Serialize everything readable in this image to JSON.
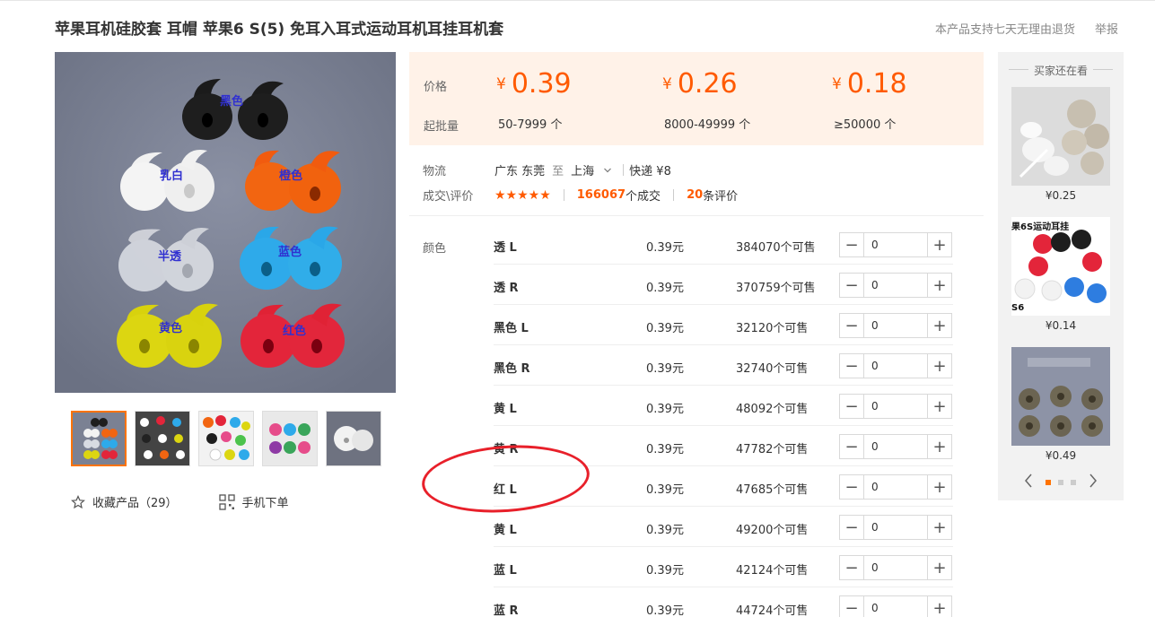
{
  "product": {
    "title": "苹果耳机硅胶套 耳帽 苹果6 S(5) 免耳入耳式运动耳机耳挂耳机套",
    "return_policy": "本产品支持七天无理由退货",
    "report": "举报"
  },
  "image_labels": {
    "black": "黑色",
    "milk_white": "乳白",
    "orange": "橙色",
    "translucent": "半透",
    "blue": "蓝色",
    "yellow": "黄色",
    "red": "红色"
  },
  "thumbnails": [
    "thumb-1",
    "thumb-2",
    "thumb-3",
    "thumb-4",
    "thumb-5"
  ],
  "actions": {
    "favorite": "收藏产品（29）",
    "mobile_order": "手机下单"
  },
  "pricing": {
    "price_label": "价格",
    "moq_label": "起批量",
    "currency": "¥",
    "tiers": [
      {
        "price": "0.39",
        "range": "50-7999 个"
      },
      {
        "price": "0.26",
        "range": "8000-49999 个"
      },
      {
        "price": "0.18",
        "range": "≥50000 个"
      }
    ]
  },
  "logistics": {
    "label": "物流",
    "from": "广东 东莞",
    "to_word": "至",
    "to": "上海",
    "express": "快递 ¥8"
  },
  "deals": {
    "label": "成交\\评价",
    "stars": "★★★★★",
    "count": "166067",
    "count_suffix": "个成交",
    "reviews": "20",
    "reviews_suffix": "条评价"
  },
  "sku": {
    "label": "颜色",
    "rows": [
      {
        "name": "透 L",
        "price": "0.39元",
        "stock": "384070个可售",
        "qty": "0"
      },
      {
        "name": "透 R",
        "price": "0.39元",
        "stock": "370759个可售",
        "qty": "0"
      },
      {
        "name": "黑色 L",
        "price": "0.39元",
        "stock": "32120个可售",
        "qty": "0"
      },
      {
        "name": "黑色 R",
        "price": "0.39元",
        "stock": "32740个可售",
        "qty": "0"
      },
      {
        "name": "黄 L",
        "price": "0.39元",
        "stock": "48092个可售",
        "qty": "0"
      },
      {
        "name": "黄 R",
        "price": "0.39元",
        "stock": "47782个可售",
        "qty": "0"
      },
      {
        "name": "红 L",
        "price": "0.39元",
        "stock": "47685个可售",
        "qty": "0"
      },
      {
        "name": "黄 L",
        "price": "0.39元",
        "stock": "49200个可售",
        "qty": "0"
      },
      {
        "name": "蓝 L",
        "price": "0.39元",
        "stock": "42124个可售",
        "qty": "0"
      },
      {
        "name": "蓝 R",
        "price": "0.39元",
        "stock": "44724个可售",
        "qty": "0"
      }
    ]
  },
  "sidebar": {
    "title": "买家还在看",
    "items": [
      {
        "price": "¥0.25"
      },
      {
        "price": "¥0.14",
        "caption_top": "果6S运动耳挂",
        "caption_bottom": "S6"
      },
      {
        "price": "¥0.49"
      }
    ]
  },
  "colors": {
    "accent": "#ff5a00",
    "price_bg": "#fff2e8",
    "annotation": "#e8202a"
  }
}
